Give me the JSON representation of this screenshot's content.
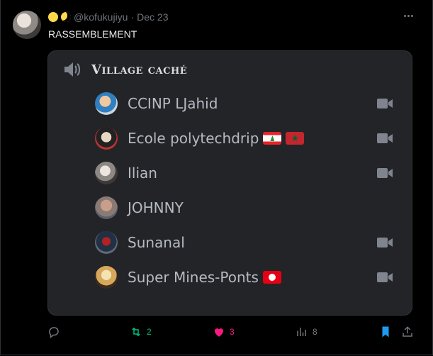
{
  "tweet": {
    "handle": "@kofukujiyu",
    "separator": "·",
    "date": "Dec 23",
    "text": "RASSEMBLEMENT"
  },
  "card": {
    "channel_name": "Village caché",
    "members": [
      {
        "name": "CCINP LJahid",
        "flags": [],
        "camera": true
      },
      {
        "name": "Ecole polytechdrip",
        "flags": [
          "lebanon",
          "morocco"
        ],
        "camera": true
      },
      {
        "name": "Ilian",
        "flags": [],
        "camera": true
      },
      {
        "name": "JOHNNY",
        "flags": [],
        "camera": false
      },
      {
        "name": "Sunanal",
        "flags": [],
        "camera": true
      },
      {
        "name": "Super Mines-Ponts",
        "flags": [
          "tunisia"
        ],
        "camera": true
      }
    ]
  },
  "actions": {
    "reply_count": "",
    "retweet_count": "2",
    "like_count": "3",
    "view_count": "8"
  },
  "colors": {
    "background": "#000000",
    "card": "#232428",
    "retweet": "#00ba7c",
    "like": "#f91880",
    "bookmark": "#1d9bf0",
    "muted": "#71767b"
  }
}
